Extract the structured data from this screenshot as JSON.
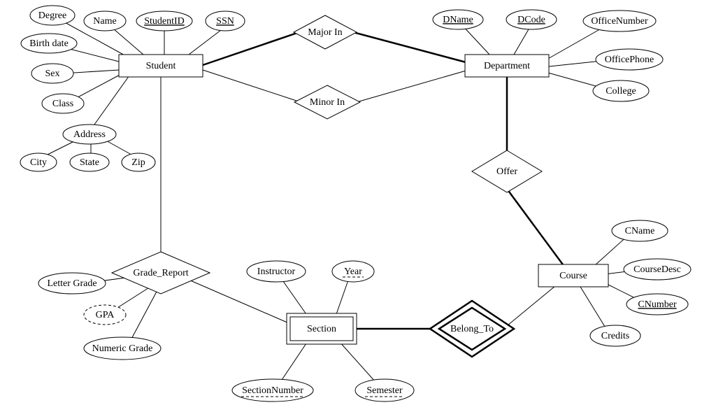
{
  "diagram": {
    "type": "entity-relationship",
    "entities": {
      "student": "Student",
      "department": "Department",
      "course": "Course",
      "section": "Section"
    },
    "relationships": {
      "major_in": "Major In",
      "minor_in": "Minor In",
      "offer": "Offer",
      "belong_to": "Belong_To",
      "grade_report": "Grade_Report"
    },
    "attributes": {
      "student": {
        "degree": "Degree",
        "name": "Name",
        "student_id": "StudentID",
        "ssn": "SSN",
        "birth_date": "Birth date",
        "sex": "Sex",
        "class": "Class",
        "address": "Address",
        "city": "City",
        "state": "State",
        "zip": "Zip"
      },
      "department": {
        "dname": "DName",
        "dcode": "DCode",
        "office_number": "OfficeNumber",
        "office_phone": "OfficePhone",
        "college": "College"
      },
      "course": {
        "cname": "CName",
        "course_desc": "CourseDesc",
        "cnumber": "CNumber",
        "credits": "Credits"
      },
      "section": {
        "instructor": "Instructor",
        "year": "Year",
        "section_number": "SectionNumber",
        "semester": "Semester"
      },
      "grade_report": {
        "letter_grade": "Letter Grade",
        "gpa": "GPA",
        "numeric_grade": "Numeric Grade"
      }
    }
  },
  "style": {
    "stroke": "#000000",
    "thin": 1,
    "thick": 2.5,
    "dash": "4,3",
    "partial_dash": "6,3"
  }
}
